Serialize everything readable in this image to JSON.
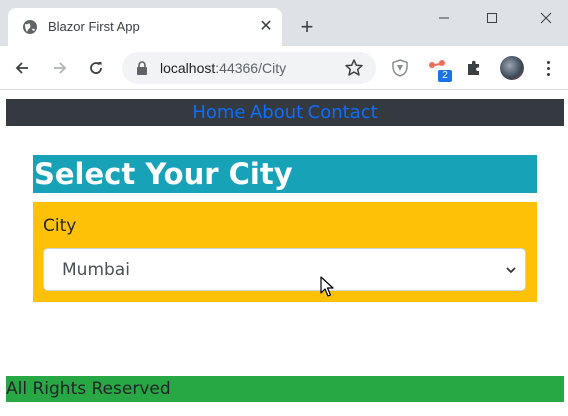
{
  "browser": {
    "tab_title": "Blazor First App",
    "url_host": "localhost",
    "url_rest": ":44366/City",
    "extension_badge": "2"
  },
  "page": {
    "nav_links": [
      "Home",
      "About",
      "Contact"
    ],
    "heading": "Select Your City",
    "city_label": "City",
    "city_selected": "Mumbai",
    "footer_text": "All Rights Reserved"
  },
  "colors": {
    "nav_bg": "#343a40",
    "heading_bg": "#17a2b8",
    "form_bg": "#ffc107",
    "footer_bg": "#28a745",
    "link": "#0d6efd"
  },
  "icons": [
    "globe-icon",
    "close-icon",
    "plus-icon",
    "minimize-icon",
    "maximize-icon",
    "window-close-icon",
    "back-arrow-icon",
    "forward-arrow-icon",
    "reload-icon",
    "lock-icon",
    "star-icon",
    "shield-extension-icon",
    "network-extension-icon",
    "puzzle-extension-icon",
    "avatar",
    "kebab-menu-icon",
    "chevron-down-icon",
    "mouse-cursor-icon"
  ]
}
